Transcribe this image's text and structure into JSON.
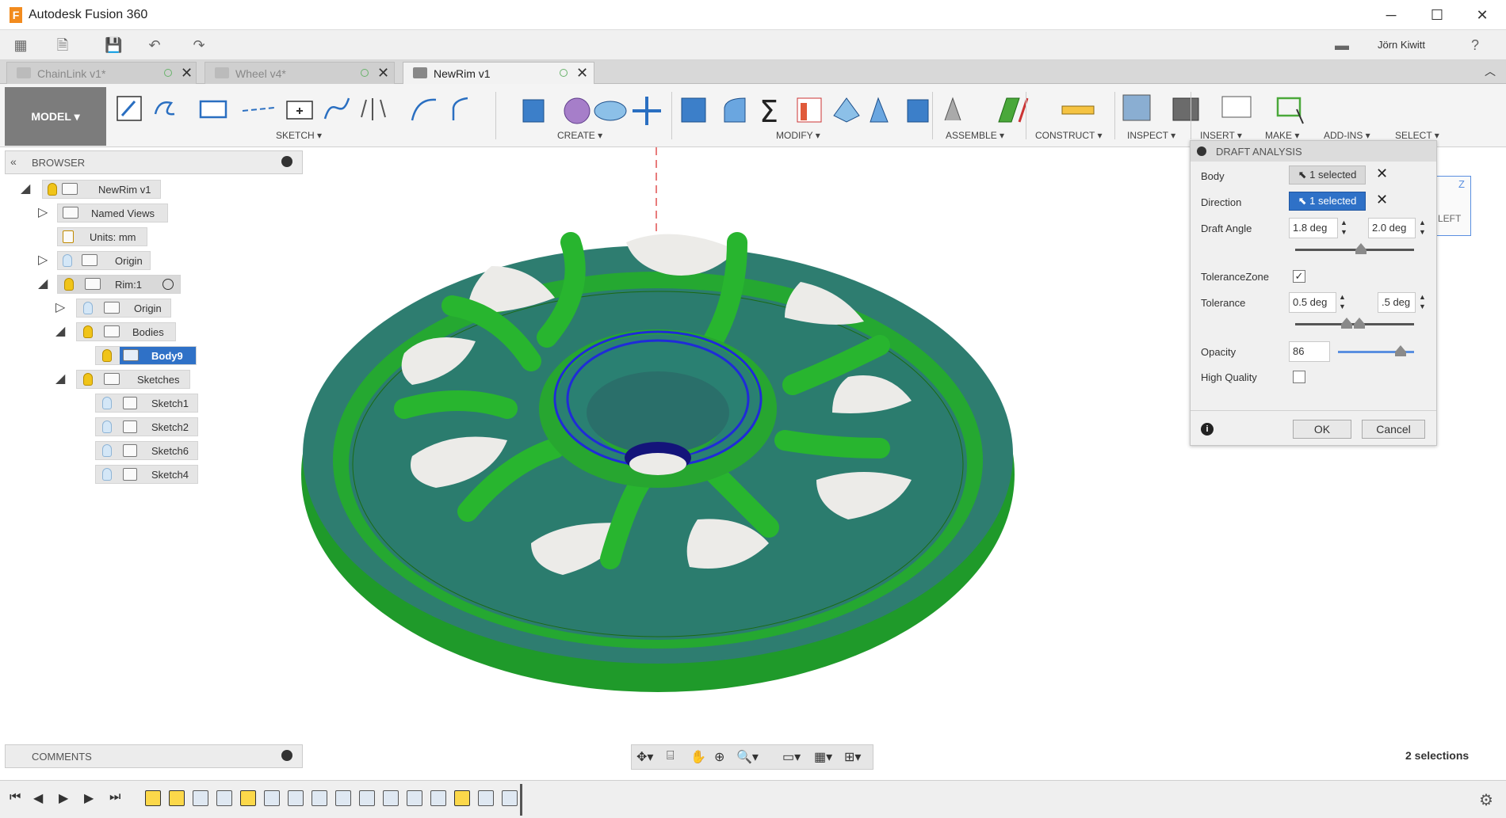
{
  "app": {
    "title": "Autodesk Fusion 360",
    "user": "Jörn Kiwitt"
  },
  "tabs": [
    {
      "label": "ChainLink v1*"
    },
    {
      "label": "Wheel v4*"
    },
    {
      "label": "NewRim v1"
    }
  ],
  "toolbar": {
    "workspace": "MODEL",
    "groups": {
      "sketch": "SKETCH",
      "create": "CREATE",
      "modify": "MODIFY",
      "assemble": "ASSEMBLE",
      "construct": "CONSTRUCT",
      "inspect": "INSPECT",
      "insert": "INSERT",
      "make": "MAKE",
      "addins": "ADD-INS",
      "select": "SELECT"
    }
  },
  "browser": {
    "header": "BROWSER",
    "root": "NewRim v1",
    "named_views": "Named Views",
    "units": "Units: mm",
    "origin": "Origin",
    "component": "Rim:1",
    "comp_origin": "Origin",
    "bodies": "Bodies",
    "body": "Body9",
    "sketches": "Sketches",
    "sketch_items": [
      "Sketch1",
      "Sketch2",
      "Sketch6",
      "Sketch4"
    ]
  },
  "draft": {
    "title": "DRAFT ANALYSIS",
    "body_label": "Body",
    "body_value": "1 selected",
    "direction_label": "Direction",
    "direction_value": "1 selected",
    "angle_label": "Draft Angle",
    "angle_min": "1.8 deg",
    "angle_max": "2.0 deg",
    "tolzone_label": "ToleranceZone",
    "tolzone_checked": true,
    "tol_label": "Tolerance",
    "tol_min": "0.5 deg",
    "tol_max": ".5 deg",
    "opacity_label": "Opacity",
    "opacity_value": "86",
    "hq_label": "High Quality",
    "hq_checked": false,
    "ok": "OK",
    "cancel": "Cancel"
  },
  "viewcube": {
    "left": "LEFT",
    "z": "Z"
  },
  "comments": "COMMENTS",
  "status": {
    "selections": "2 selections"
  },
  "colors": {
    "model_green": "#1fa52b",
    "model_teal": "#2f8275",
    "highlight_blue": "#1f2bd8",
    "select_blue": "#2f71c7"
  }
}
